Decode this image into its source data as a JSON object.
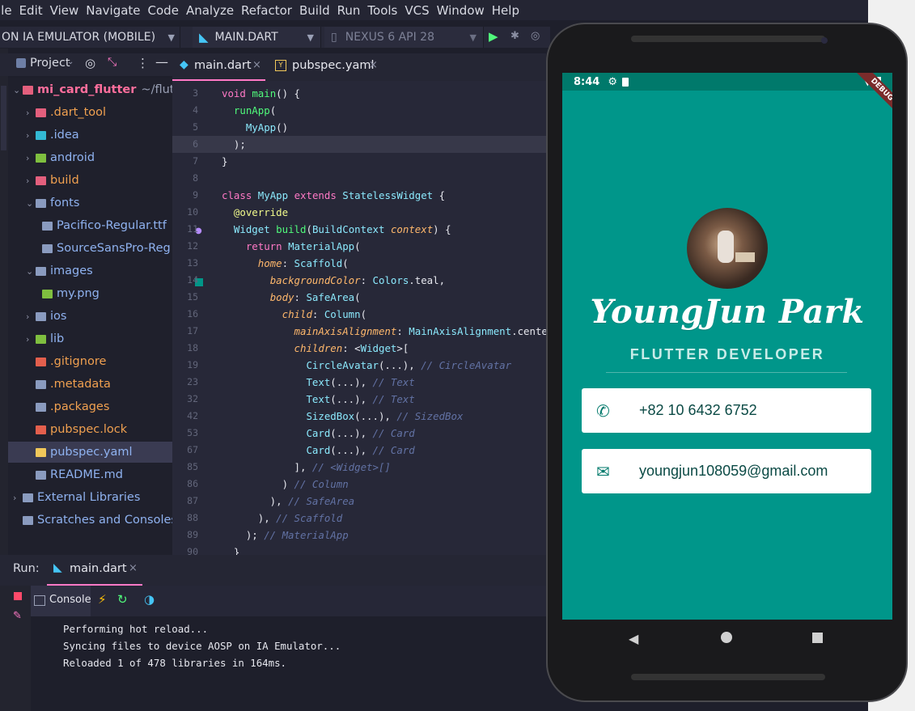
{
  "menu": [
    "ile",
    "Edit",
    "View",
    "Navigate",
    "Code",
    "Analyze",
    "Refactor",
    "Build",
    "Run",
    "Tools",
    "VCS",
    "Window",
    "Help"
  ],
  "toolbar": {
    "device_target": "ON IA EMULATOR (MOBILE)",
    "run_config": "MAIN.DART",
    "device": "NEXUS 6 API 28"
  },
  "project_panel": {
    "title": "Project",
    "root_name": "mi_card_flutter",
    "root_path": "~/flutter/",
    "items": [
      {
        "label": "root",
        "name": ".dart_tool",
        "color": "#e35f7d"
      },
      {
        "label": "root",
        "name": ".idea",
        "color": "#33b9d4"
      },
      {
        "label": "root",
        "name": "android",
        "color": "#7fbf3f"
      },
      {
        "label": "root",
        "name": "build",
        "color": "#e35f7d"
      },
      {
        "label": "root",
        "name": "fonts",
        "color": "#8a9bbf"
      },
      {
        "label": "child",
        "name": "Pacifico-Regular.ttf",
        "color": "#8a9bbf"
      },
      {
        "label": "child",
        "name": "SourceSansPro-Reg",
        "color": "#8a9bbf"
      },
      {
        "label": "root",
        "name": "images",
        "color": "#8a9bbf"
      },
      {
        "label": "child",
        "name": "my.png",
        "color": "#7fbf3f"
      },
      {
        "label": "root",
        "name": "ios",
        "color": "#8a9bbf"
      },
      {
        "label": "root",
        "name": "lib",
        "color": "#7fbf3f"
      },
      {
        "label": "file",
        "name": ".gitignore",
        "color": "#e35f4d"
      },
      {
        "label": "file",
        "name": ".metadata",
        "color": "#8a9bbf"
      },
      {
        "label": "file",
        "name": ".packages",
        "color": "#8a9bbf"
      },
      {
        "label": "file",
        "name": "pubspec.lock",
        "color": "#e35f4d"
      },
      {
        "label": "file",
        "name": "pubspec.yaml",
        "color": "#f1c85a"
      },
      {
        "label": "file",
        "name": "README.md",
        "color": "#8a9bbf"
      },
      {
        "label": "root",
        "name": "External Libraries",
        "color": "#8a9bbf"
      },
      {
        "label": "file",
        "name": "Scratches and Consoles",
        "color": "#8a9bbf"
      }
    ]
  },
  "tabs": [
    "main.dart",
    "pubspec.yaml"
  ],
  "code_lines": [
    {
      "n": "3",
      "t": "void main() {"
    },
    {
      "n": "4",
      "t": "  runApp("
    },
    {
      "n": "5",
      "t": "    MyApp()"
    },
    {
      "n": "6",
      "t": "  );"
    },
    {
      "n": "7",
      "t": "}"
    },
    {
      "n": "8",
      "t": ""
    },
    {
      "n": "9",
      "t": "class MyApp extends StatelessWidget {"
    },
    {
      "n": "10",
      "t": "  @override"
    },
    {
      "n": "11",
      "t": "  Widget build(BuildContext context) {"
    },
    {
      "n": "12",
      "t": "    return MaterialApp("
    },
    {
      "n": "13",
      "t": "      home: Scaffold("
    },
    {
      "n": "14",
      "t": "        backgroundColor: Colors.teal,"
    },
    {
      "n": "15",
      "t": "        body: SafeArea("
    },
    {
      "n": "16",
      "t": "          child: Column("
    },
    {
      "n": "17",
      "t": "            mainAxisAlignment: MainAxisAlignment.center,"
    },
    {
      "n": "18",
      "t": "            children: <Widget>["
    },
    {
      "n": "19",
      "t": "              CircleAvatar(...), // CircleAvatar"
    },
    {
      "n": "23",
      "t": "              Text(...), // Text"
    },
    {
      "n": "32",
      "t": "              Text(...), // Text"
    },
    {
      "n": "42",
      "t": "              SizedBox(...), // SizedBox"
    },
    {
      "n": "53",
      "t": "              Card(...), // Card"
    },
    {
      "n": "67",
      "t": "              Card(...), // Card"
    },
    {
      "n": "85",
      "t": "            ], // <Widget>[]"
    },
    {
      "n": "86",
      "t": "          ) // Column"
    },
    {
      "n": "87",
      "t": "        ), // SafeArea"
    },
    {
      "n": "88",
      "t": "      ), // Scaffold"
    },
    {
      "n": "89",
      "t": "    ); // MaterialApp"
    },
    {
      "n": "90",
      "t": "  }"
    }
  ],
  "run_panel": {
    "label": "Run:",
    "tab": "main.dart",
    "console_tab": "Console",
    "lines": [
      "Performing hot reload...",
      "Syncing files to device AOSP on IA Emulator...",
      "Reloaded 1 of 478 libraries in 164ms."
    ]
  },
  "phone": {
    "time": "8:44",
    "debug_banner": "DEBUG",
    "name": "YoungJun Park",
    "title": "FLUTTER DEVELOPER",
    "phone_number": "+82 10 6432 6752",
    "email": "youngjun108059@gmail.com",
    "bg_color": "#00968a",
    "accent": "#00796b"
  }
}
